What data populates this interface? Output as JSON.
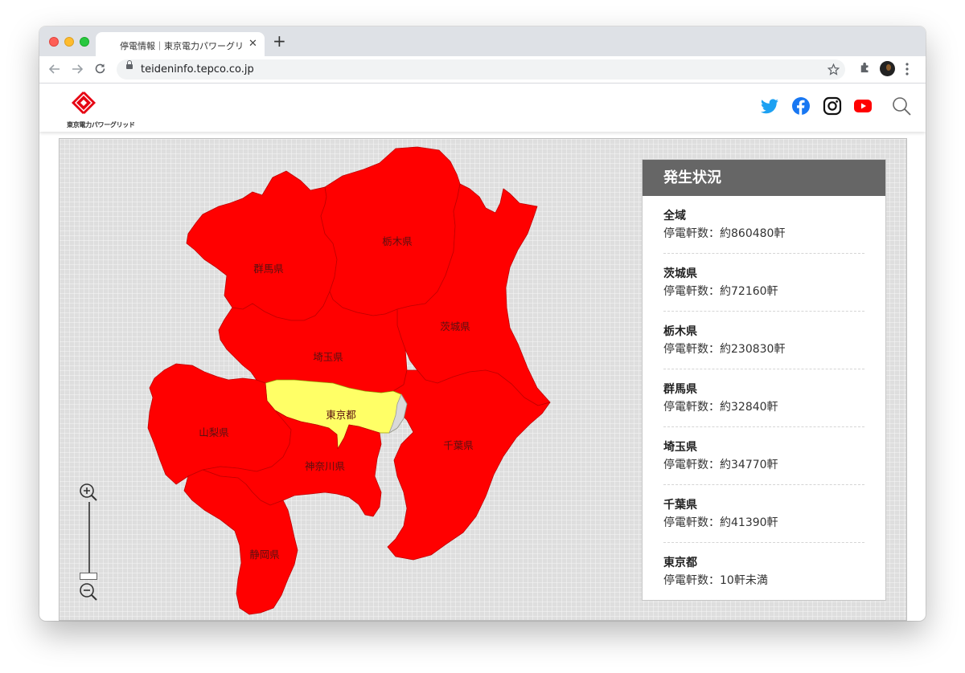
{
  "browser": {
    "tab_title": "停電情報｜東京電力パワーグリッド",
    "tab_close": "✕",
    "new_tab": "+",
    "url": "teideninfo.tepco.co.jp"
  },
  "site": {
    "logo_text": "東京電力パワーグリッド"
  },
  "map": {
    "labels": {
      "tochigi": "栃木県",
      "gunma": "群馬県",
      "ibaraki": "茨城県",
      "saitama": "埼玉県",
      "tokyo": "東京都",
      "yamanashi": "山梨県",
      "chiba": "千葉県",
      "kanagawa": "神奈川県",
      "shizuoka": "静岡県"
    },
    "colors": {
      "outage": "#ff0000",
      "minor": "#ffff66",
      "none": "#d9d9d9"
    }
  },
  "panel": {
    "title": "発生状況",
    "entries": [
      {
        "name": "全域",
        "count": "停電軒数：約860480軒"
      },
      {
        "name": "茨城県",
        "count": "停電軒数：約72160軒"
      },
      {
        "name": "栃木県",
        "count": "停電軒数：約230830軒"
      },
      {
        "name": "群馬県",
        "count": "停電軒数：約32840軒"
      },
      {
        "name": "埼玉県",
        "count": "停電軒数：約34770軒"
      },
      {
        "name": "千葉県",
        "count": "停電軒数：約41390軒"
      },
      {
        "name": "東京都",
        "count": "停電軒数：10軒未満"
      }
    ]
  }
}
